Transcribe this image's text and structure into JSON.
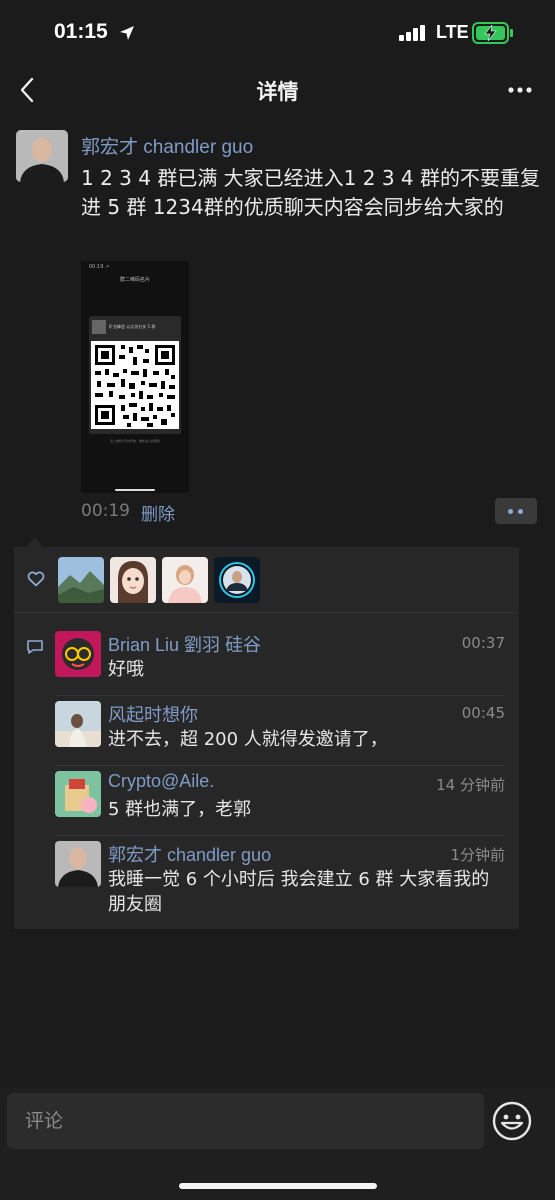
{
  "status_bar": {
    "time": "01:15",
    "network": "LTE"
  },
  "nav": {
    "title": "详情"
  },
  "post": {
    "author": "郭宏才 chandler guo",
    "text": "1 2 3 4 群已满 大家已经进入1 2 3 4 群的不要重复进 5 群 1234群的优质聊天内容会同步给大家的",
    "time": "00:19",
    "delete_label": "删除",
    "image": {
      "status_time": "00:19 ↗",
      "title": "群二维码名片",
      "card_name": "矿业峰会 以太坊分叉 5 群",
      "footer": "该二维码7天内有效，重新进入将更新"
    }
  },
  "likes": {
    "icon": "heart-icon",
    "users": [
      "like-avatar-mountain",
      "like-avatar-cartoon",
      "like-avatar-girl",
      "like-avatar-man"
    ]
  },
  "comments": [
    {
      "name": "Brian Liu 劉羽 硅谷",
      "time": "00:37",
      "text": "好哦"
    },
    {
      "name": "风起时想你",
      "time": "00:45",
      "text": "进不去，超 200 人就得发邀请了，"
    },
    {
      "name": "Crypto@Aile.",
      "time": "14 分钟前",
      "text": "5 群也满了，老郭"
    },
    {
      "name": "郭宏才 chandler guo",
      "time": "1分钟前",
      "text": "我睡一觉 6 个小时后 我会建立 6 群 大家看我的朋友圈"
    }
  ],
  "input": {
    "placeholder": "评论"
  },
  "colors": {
    "background": "#1b1b1b",
    "panel": "#272727",
    "link": "#7f9bc6",
    "battery": "#34c759"
  }
}
